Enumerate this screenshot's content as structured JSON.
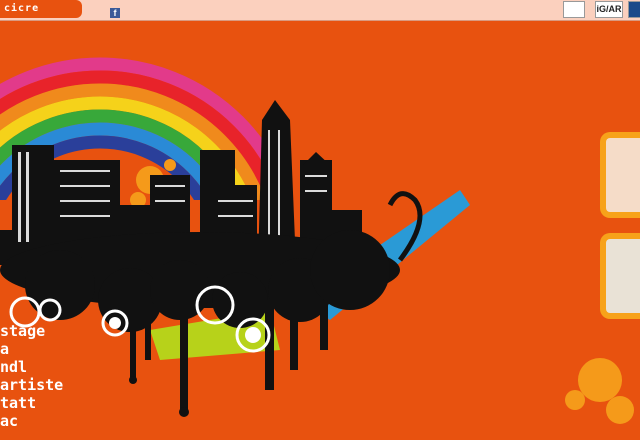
{
  "topbar": {
    "logo_text": "cicre",
    "facebook_label": "f",
    "badges": [
      "",
      "iG/AR",
      ""
    ]
  },
  "menu": {
    "items": [
      "stage",
      "a",
      "ndl",
      "artiste",
      "tatt",
      "ac"
    ]
  },
  "colors": {
    "background": "#e8520f",
    "topbar": "#fbd0be",
    "card": "#f7a21a"
  }
}
